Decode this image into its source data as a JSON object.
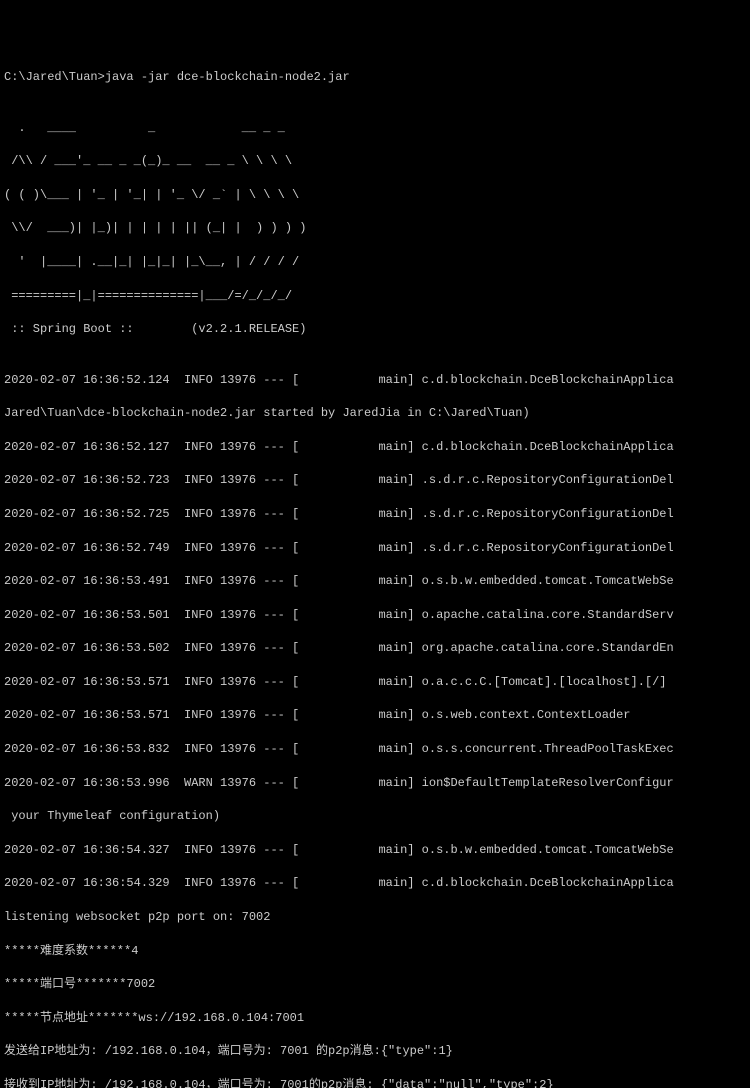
{
  "prompt": "C:\\Jared\\Tuan>java -jar dce-blockchain-node2.jar",
  "ascii_art": [
    "",
    "  .   ____          _            __ _ _",
    " /\\\\ / ___'_ __ _ _(_)_ __  __ _ \\ \\ \\ \\",
    "( ( )\\___ | '_ | '_| | '_ \\/ _` | \\ \\ \\ \\",
    " \\\\/  ___)| |_)| | | | | || (_| |  ) ) ) )",
    "  '  |____| .__|_| |_|_| |_\\__, | / / / /",
    " =========|_|==============|___/=/_/_/_/"
  ],
  "boot_line": " :: Spring Boot ::        (v2.2.1.RELEASE)",
  "log_lines": [
    "",
    "2020-02-07 16:36:52.124  INFO 13976 --- [           main] c.d.blockchain.DceBlockchainApplica",
    "Jared\\Tuan\\dce-blockchain-node2.jar started by JaredJia in C:\\Jared\\Tuan)",
    "2020-02-07 16:36:52.127  INFO 13976 --- [           main] c.d.blockchain.DceBlockchainApplica",
    "2020-02-07 16:36:52.723  INFO 13976 --- [           main] .s.d.r.c.RepositoryConfigurationDel",
    "2020-02-07 16:36:52.725  INFO 13976 --- [           main] .s.d.r.c.RepositoryConfigurationDel",
    "2020-02-07 16:36:52.749  INFO 13976 --- [           main] .s.d.r.c.RepositoryConfigurationDel",
    "2020-02-07 16:36:53.491  INFO 13976 --- [           main] o.s.b.w.embedded.tomcat.TomcatWebSe",
    "2020-02-07 16:36:53.501  INFO 13976 --- [           main] o.apache.catalina.core.StandardServ",
    "2020-02-07 16:36:53.502  INFO 13976 --- [           main] org.apache.catalina.core.StandardEn",
    "2020-02-07 16:36:53.571  INFO 13976 --- [           main] o.a.c.c.C.[Tomcat].[localhost].[/]",
    "2020-02-07 16:36:53.571  INFO 13976 --- [           main] o.s.web.context.ContextLoader",
    "2020-02-07 16:36:53.832  INFO 13976 --- [           main] o.s.s.concurrent.ThreadPoolTaskExec",
    "2020-02-07 16:36:53.996  WARN 13976 --- [           main] ion$DefaultTemplateResolverConfigur",
    " your Thymeleaf configuration)",
    "2020-02-07 16:36:54.327  INFO 13976 --- [           main] o.s.b.w.embedded.tomcat.TomcatWebSe",
    "2020-02-07 16:36:54.329  INFO 13976 --- [           main] c.d.blockchain.DceBlockchainApplica",
    "listening websocket p2p port on: 7002",
    "*****难度系数******4",
    "*****端口号*******7002",
    "*****节点地址*******ws://192.168.0.104:7001",
    "发送给IP地址为: /192.168.0.104，端口号为: 7001 的p2p消息:{\"type\":1}",
    "接收到IP地址为: /192.168.0.104，端口号为: 7001的p2p消息: {\"data\":\"null\",\"type\":2}"
  ]
}
